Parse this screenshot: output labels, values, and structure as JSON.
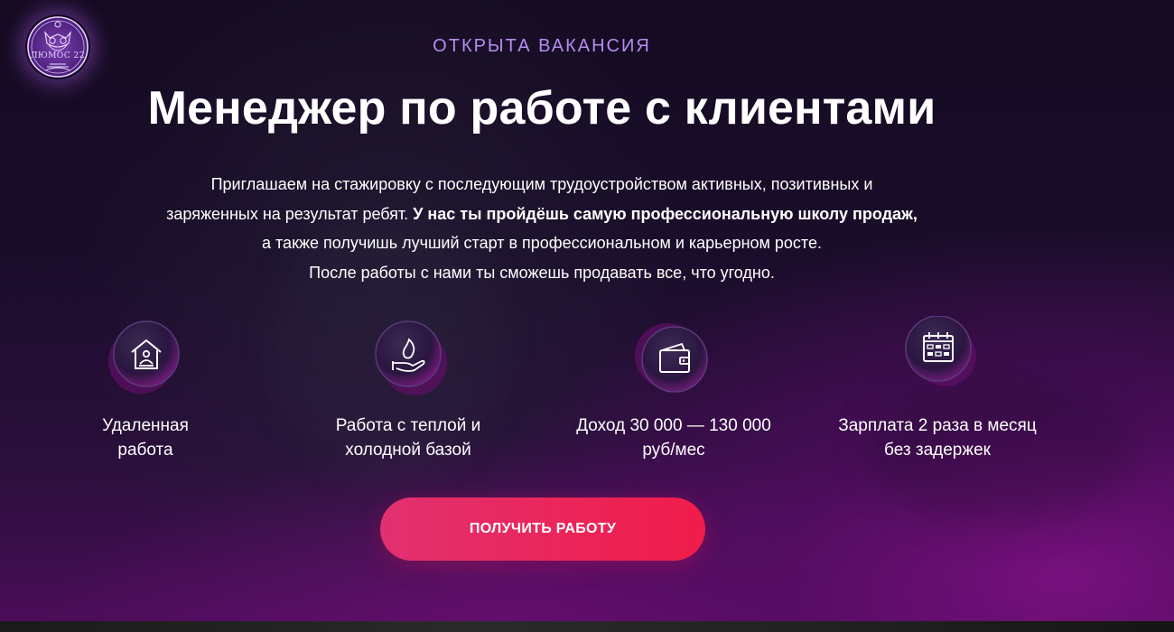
{
  "logo": {
    "text": "ЛЮМОС 22"
  },
  "hero": {
    "eyebrow": "ОТКРЫТА ВАКАНСИЯ",
    "title": "Менеджер по работе с клиентами",
    "description": {
      "line1": "Приглашаем на стажировку с последующим трудоустройством активных, позитивных и",
      "line2_regular": "заряженных на результат ребят. ",
      "line2_bold": "У нас ты пройдёшь самую профессиональную школу продаж,",
      "line3": "а также получишь лучший старт в профессиональном и карьерном росте.",
      "line4": "После работы с нами ты сможешь продавать все, что угодно."
    }
  },
  "features": [
    {
      "icon": "remote-work-house-icon",
      "line1": "Удаленная",
      "line2": "работа"
    },
    {
      "icon": "hand-fire-icon",
      "line1": "Работа с теплой и",
      "line2": "холодной базой"
    },
    {
      "icon": "wallet-icon",
      "line1": "Доход 30 000 — 130 000",
      "line2": "руб/мес"
    },
    {
      "icon": "calendar-icon",
      "line1": "Зарплата 2 раза в месяц",
      "line2": "без задержек"
    }
  ],
  "cta": {
    "label": "ПОЛУЧИТЬ РАБОТУ"
  },
  "colors": {
    "accent": "#b78cf0",
    "button_start": "#e23170",
    "button_end": "#f01c4a",
    "background": "#150b22"
  }
}
